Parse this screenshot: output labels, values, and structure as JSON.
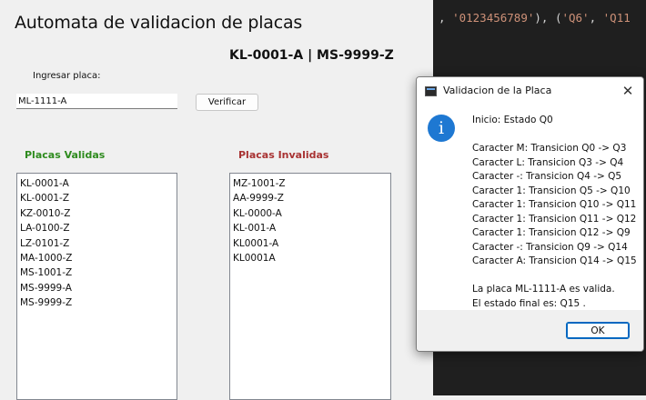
{
  "app": {
    "title": "Automata de validacion de placas",
    "range_text": "KL-0001-A | MS-9999-Z",
    "input_label": "Ingresar placa:",
    "input_value": "ML-1111-A",
    "verify_label": "Verificar",
    "valid_header": "Placas Validas",
    "invalid_header": "Placas Invalidas",
    "valid_list": [
      "KL-0001-A",
      "KL-0001-Z",
      "KZ-0010-Z",
      "LA-0100-Z",
      "LZ-0101-Z",
      "MA-1000-Z",
      "MS-1001-Z",
      "MS-9999-A",
      "MS-9999-Z"
    ],
    "invalid_list": [
      "MZ-1001-Z",
      "AA-9999-Z",
      "KL-0000-A",
      "KL-001-A",
      "KL0001-A",
      "KL0001A"
    ],
    "colors": {
      "valid": "#2e8b1e",
      "invalid": "#a83232"
    }
  },
  "editor": {
    "tokens": [
      {
        "t": ", ",
        "k": "punc"
      },
      {
        "t": "'0123456789'",
        "k": "str"
      },
      {
        "t": "), (",
        "k": "punc"
      },
      {
        "t": "'Q6'",
        "k": "str"
      },
      {
        "t": ", ",
        "k": "punc"
      },
      {
        "t": "'Q11",
        "k": "str"
      }
    ]
  },
  "dialog": {
    "title": "Validacion de la Placa",
    "close": "✕",
    "icon": "info-icon",
    "lines": [
      "Inicio: Estado Q0",
      "",
      "Caracter M: Transicion Q0 -> Q3",
      "Caracter L: Transicion Q3 -> Q4",
      "Caracter -: Transicion Q4 -> Q5",
      "Caracter 1: Transicion Q5 -> Q10",
      "Caracter 1: Transicion Q10 -> Q11",
      "Caracter 1: Transicion Q11 -> Q12",
      "Caracter 1: Transicion Q12 -> Q9",
      "Caracter -: Transicion Q9 -> Q14",
      "Caracter A: Transicion Q14 -> Q15",
      "",
      "La placa ML-1111-A es valida.",
      "El estado final es: Q15 ."
    ],
    "ok_label": "OK"
  }
}
